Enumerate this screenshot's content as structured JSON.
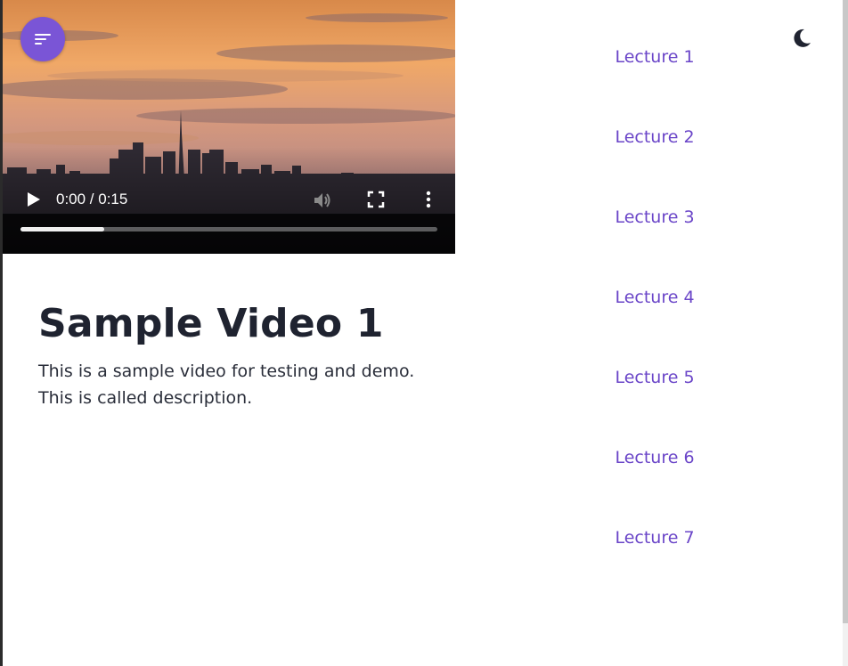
{
  "video": {
    "time_display": "0:00 / 0:15",
    "progress_fraction": 0.2
  },
  "content": {
    "title": "Sample Video 1",
    "description_line1": "This is a sample video for testing and demo.",
    "description_line2": "This is called description."
  },
  "lectures": [
    {
      "label": "Lecture 1"
    },
    {
      "label": "Lecture 2"
    },
    {
      "label": "Lecture 3"
    },
    {
      "label": "Lecture 4"
    },
    {
      "label": "Lecture 5"
    },
    {
      "label": "Lecture 6"
    },
    {
      "label": "Lecture 7"
    }
  ],
  "icons": {
    "menu": "menu-lines-icon",
    "theme": "moon-icon",
    "play": "play-icon",
    "volume": "volume-icon",
    "fullscreen": "fullscreen-icon",
    "more": "more-vertical-icon"
  },
  "colors": {
    "accent": "#7a55d6",
    "lecture_text": "#6a45c8",
    "title_text": "#1f2330"
  }
}
